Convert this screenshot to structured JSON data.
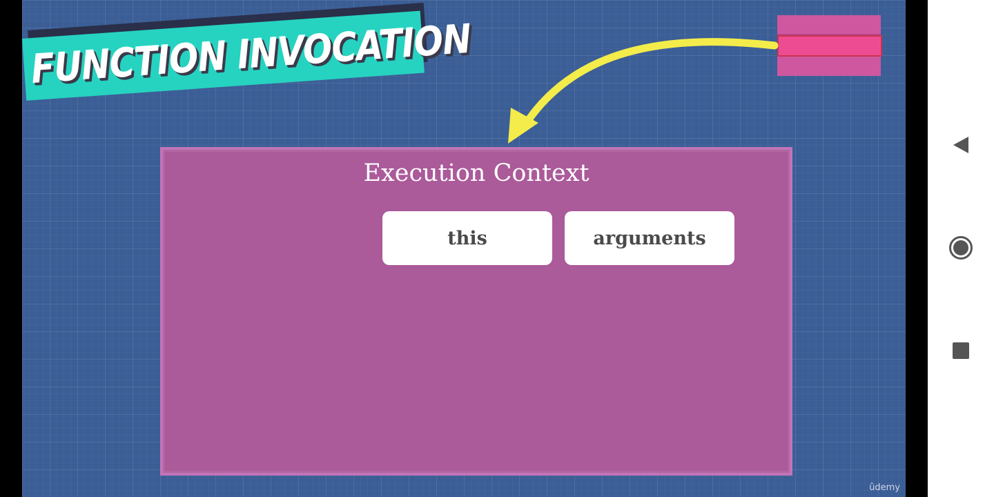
{
  "slide": {
    "banner_title": "FUNCTION INVOCATION",
    "panel_title": "Execution Context",
    "boxes": [
      "this",
      "arguments"
    ],
    "watermark": "ûdemy"
  },
  "nav": {
    "back_icon": "back-triangle-icon",
    "home_icon": "home-circle-icon",
    "recents_icon": "recents-square-icon"
  },
  "colors": {
    "background": "#3b5e96",
    "banner": "#26d3c0",
    "panel": "#ab5a9a",
    "arrow": "#f3ec4a",
    "stack": "#cf57a0",
    "stack_active": "#ee4c92"
  }
}
